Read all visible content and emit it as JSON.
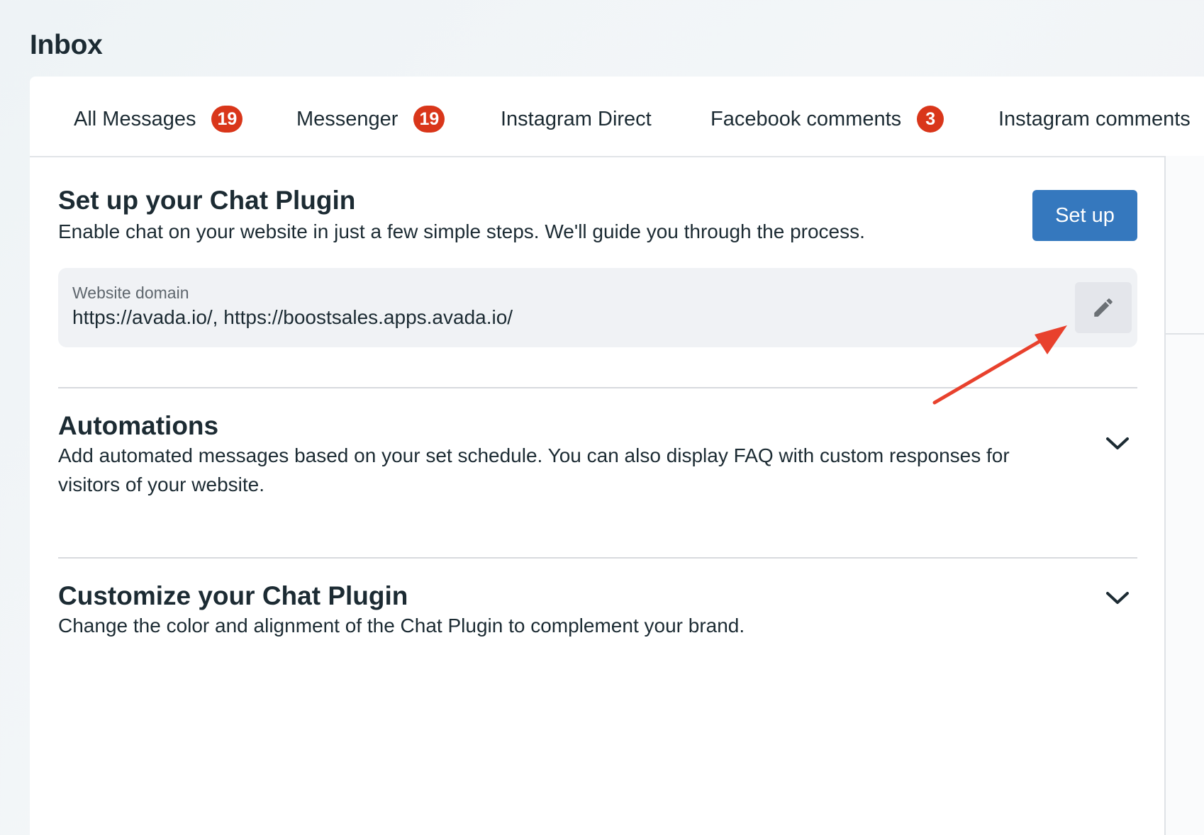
{
  "header": {
    "title": "Inbox"
  },
  "tabs": [
    {
      "label": "All Messages",
      "badge": "19"
    },
    {
      "label": "Messenger",
      "badge": "19"
    },
    {
      "label": "Instagram Direct"
    },
    {
      "label": "Facebook comments",
      "badge": "3"
    },
    {
      "label": "Instagram comments"
    }
  ],
  "setup_section": {
    "title": "Set up your Chat Plugin",
    "description": "Enable chat on your website in just a few simple steps. We'll guide you through the process.",
    "button_label": "Set up",
    "domain_label": "Website domain",
    "domain_value": "https://avada.io/, https://boostsales.apps.avada.io/",
    "edit_icon": "pencil-icon"
  },
  "automations_section": {
    "title": "Automations",
    "description": "Add automated messages based on your set schedule. You can also display FAQ with custom responses for visitors of your website.",
    "expand_icon": "chevron-down-icon"
  },
  "customize_section": {
    "title": "Customize your Chat Plugin",
    "description": "Change the color and alignment of the Chat Plugin to complement your brand.",
    "expand_icon": "chevron-down-icon"
  },
  "colors": {
    "primary_button": "#3578be",
    "badge": "#d9361a",
    "annotation_arrow": "#e8412d",
    "text": "#1c2b33"
  }
}
